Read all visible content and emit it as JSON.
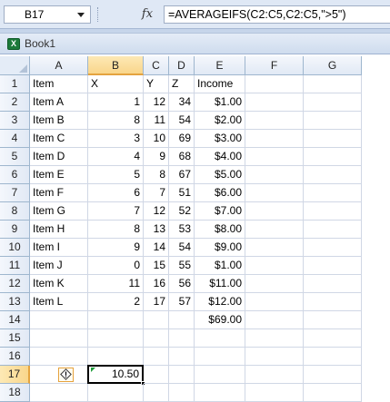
{
  "formula_bar": {
    "name_box": "B17",
    "fx_label": "fx",
    "formula": "=AVERAGEIFS(C2:C5,C2:C5,\">5\")"
  },
  "workbook": {
    "title": "Book1"
  },
  "columns": [
    "A",
    "B",
    "C",
    "D",
    "E",
    "F",
    "G"
  ],
  "rows": [
    {
      "n": "1",
      "A": "Item",
      "B": "X",
      "C": "Y",
      "D": "Z",
      "E": "Income"
    },
    {
      "n": "2",
      "A": "Item A",
      "B": "1",
      "C": "12",
      "D": "34",
      "E": "$1.00"
    },
    {
      "n": "3",
      "A": "Item B",
      "B": "8",
      "C": "11",
      "D": "54",
      "E": "$2.00"
    },
    {
      "n": "4",
      "A": "Item C",
      "B": "3",
      "C": "10",
      "D": "69",
      "E": "$3.00"
    },
    {
      "n": "5",
      "A": "Item D",
      "B": "4",
      "C": "9",
      "D": "68",
      "E": "$4.00"
    },
    {
      "n": "6",
      "A": "Item E",
      "B": "5",
      "C": "8",
      "D": "67",
      "E": "$5.00"
    },
    {
      "n": "7",
      "A": "Item F",
      "B": "6",
      "C": "7",
      "D": "51",
      "E": "$6.00"
    },
    {
      "n": "8",
      "A": "Item G",
      "B": "7",
      "C": "12",
      "D": "52",
      "E": "$7.00"
    },
    {
      "n": "9",
      "A": "Item H",
      "B": "8",
      "C": "13",
      "D": "53",
      "E": "$8.00"
    },
    {
      "n": "10",
      "A": "Item I",
      "B": "9",
      "C": "14",
      "D": "54",
      "E": "$9.00"
    },
    {
      "n": "11",
      "A": "Item J",
      "B": "0",
      "C": "15",
      "D": "55",
      "E": "$1.00"
    },
    {
      "n": "12",
      "A": "Item K",
      "B": "11",
      "C": "16",
      "D": "56",
      "E": "$11.00"
    },
    {
      "n": "13",
      "A": "Item L",
      "B": "2",
      "C": "17",
      "D": "57",
      "E": "$12.00"
    },
    {
      "n": "14",
      "A": "",
      "B": "",
      "C": "",
      "D": "",
      "E": "$69.00"
    },
    {
      "n": "15",
      "A": "",
      "B": "",
      "C": "",
      "D": "",
      "E": ""
    },
    {
      "n": "16",
      "A": "",
      "B": "",
      "C": "",
      "D": "",
      "E": ""
    },
    {
      "n": "17",
      "A": "",
      "B": "10.50",
      "C": "",
      "D": "",
      "E": ""
    },
    {
      "n": "18",
      "A": "",
      "B": "",
      "C": "",
      "D": "",
      "E": ""
    }
  ],
  "active_cell": {
    "column": "B",
    "row": "17",
    "value": "10.50"
  },
  "smart_tag": {
    "icon": "error-warning-icon",
    "mark": "!",
    "color": "#e6a23c"
  },
  "colors": {
    "header_bg": "#e4ecf7",
    "selected_header": "#f9d68b",
    "gridline": "#d0d7e5"
  }
}
